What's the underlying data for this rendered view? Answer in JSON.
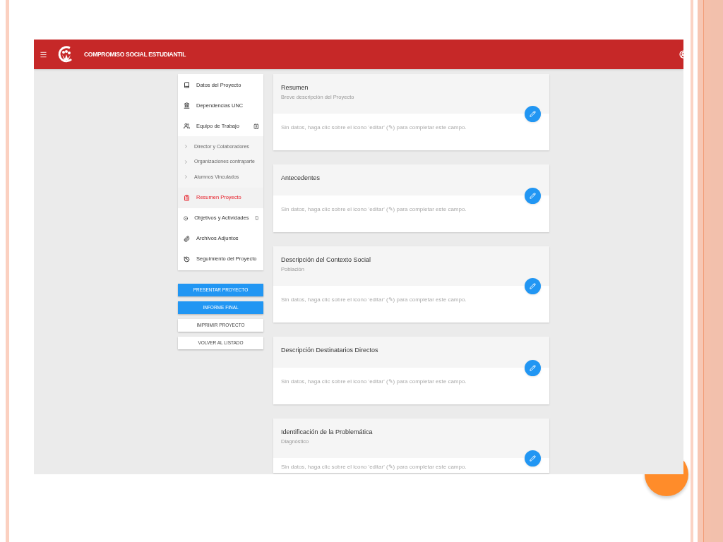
{
  "app": {
    "title": "COMPROMISO SOCIAL ESTUDIANTIL"
  },
  "sidebar": {
    "items": [
      {
        "label": "Datos del Proyecto",
        "selected": false
      },
      {
        "label": "Dependencias UNC",
        "selected": false
      },
      {
        "label": "Equipo de Trabajo",
        "selected": false,
        "expanded": true,
        "children": [
          {
            "label": "Director y Colaboradores",
            "selected": false
          },
          {
            "label": "Organizaciones contraparte",
            "selected": false
          },
          {
            "label": "Alumnos Vinculados",
            "selected": false
          }
        ]
      },
      {
        "label": "Resumen Proyecto",
        "selected": true
      },
      {
        "label": "Objetivos y Actividades",
        "selected": false
      },
      {
        "label": "Archivos Adjuntos",
        "selected": false
      },
      {
        "label": "Seguimiento del Proyecto",
        "selected": false
      }
    ]
  },
  "buttons": [
    {
      "label": "PRESENTAR PROYECTO",
      "kind": "primary"
    },
    {
      "label": "INFORME FINAL",
      "kind": "primary"
    },
    {
      "label": "IMPRIMIR PROYECTO",
      "kind": "secondary"
    },
    {
      "label": "VOLVER AL LISTADO",
      "kind": "secondary"
    }
  ],
  "sections": [
    {
      "title": "Resumen",
      "subtitle": "Breve descripción del Proyecto",
      "empty_text": "Sin datos, haga clic sobre el icono 'editar' (✎) para completar este campo."
    },
    {
      "title": "Antecedentes",
      "empty_text": "Sin datos, haga clic sobre el icono 'editar' (✎) para completar este campo."
    },
    {
      "title": "Descripción del Contexto Social",
      "subtitle": "Población",
      "empty_text": "Sin datos, haga clic sobre el icono 'editar' (✎) para completar este campo."
    },
    {
      "title": "Descripción Destinatarios Directos",
      "empty_text": "Sin datos, haga clic sobre el icono 'editar' (✎) para completar este campo."
    },
    {
      "title": "Identificación de la Problemática",
      "subtitle": "Diagnóstico",
      "empty_text": "Sin datos, haga clic sobre el icono 'editar' (✎) para completar este campo."
    }
  ]
}
